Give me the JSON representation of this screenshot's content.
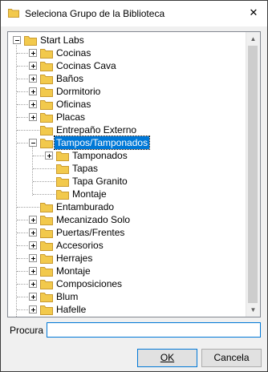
{
  "window": {
    "title": "Seleciona Grupo de la Biblioteca",
    "close_glyph": "✕"
  },
  "tree": {
    "root": "Start Labs",
    "items": [
      "Cocinas",
      "Cocinas Cava",
      "Baños",
      "Dormitorio",
      "Oficinas",
      "Placas",
      "Entrepaño Externo",
      "Tampos/Tamponados",
      "Tamponados",
      "Tapas",
      "Tapa Granito",
      "Montaje",
      "Entamburado",
      "Mecanizado Solo",
      "Puertas/Frentes",
      "Accesorios",
      "Herrajes",
      "Montaje",
      "Composiciones",
      "Blum",
      "Hafelle"
    ],
    "selected": "Tampos/Tamponados"
  },
  "search": {
    "label": "Procura",
    "value": ""
  },
  "buttons": {
    "ok": "OK",
    "cancel": "Cancela"
  },
  "colors": {
    "folder": "#f2c94c",
    "selection": "#0078d7",
    "focus_border": "#0078d7"
  }
}
